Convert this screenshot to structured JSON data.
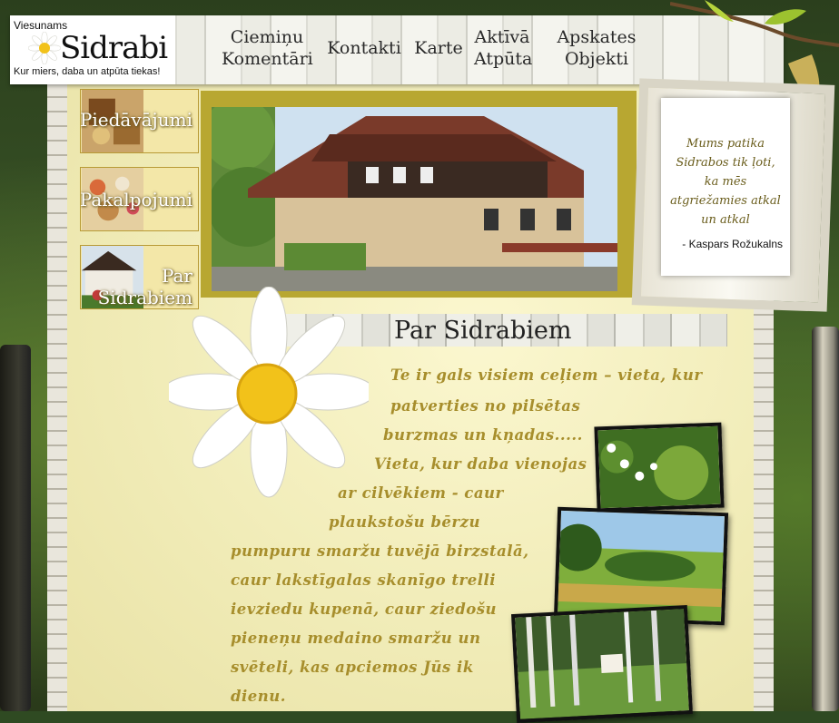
{
  "logo": {
    "pre_title": "Viesunams",
    "name": "Sidrabi",
    "tagline": "Kur miers, daba un atpūta tiekas!"
  },
  "nav": [
    {
      "line1": "Ciemiņu",
      "line2": "Komentāri"
    },
    {
      "line1": "Kontakti",
      "line2": ""
    },
    {
      "line1": "Karte",
      "line2": ""
    },
    {
      "line1": "Aktīvā",
      "line2": "Atpūta"
    },
    {
      "line1": "Apskates",
      "line2": "Objekti"
    }
  ],
  "menu": [
    {
      "label": "Piedāvājumi"
    },
    {
      "label": "Pakalpojumi"
    },
    {
      "label_line1": "Par",
      "label_line2": "Sidrabiem"
    }
  ],
  "quote": {
    "lines": [
      "Mums patika",
      "Sidrabos tik ļoti,",
      "ka mēs",
      "atgriežamies atkal",
      "un atkal"
    ],
    "author": "- Kaspars Rožukalns"
  },
  "section": {
    "title": "Par Sidrabiem",
    "lines": [
      "Te ir gals visiem ceļiem – vieta, kur",
      "patverties no pilsētas",
      "burzmas un kņadas.....",
      "Vieta, kur daba vienojas",
      "ar cilvēkiem - caur",
      "plaukstošu bērzu",
      "pumpuru smaržu tuvējā birzstalā,",
      "caur lakstīgalas skanīgo trelli",
      "ievziedu kupenā, caur ziedošu",
      "pieneņu medaino smaržu un",
      "svēteli, kas apciemos Jūs ik",
      "dienu."
    ]
  }
}
